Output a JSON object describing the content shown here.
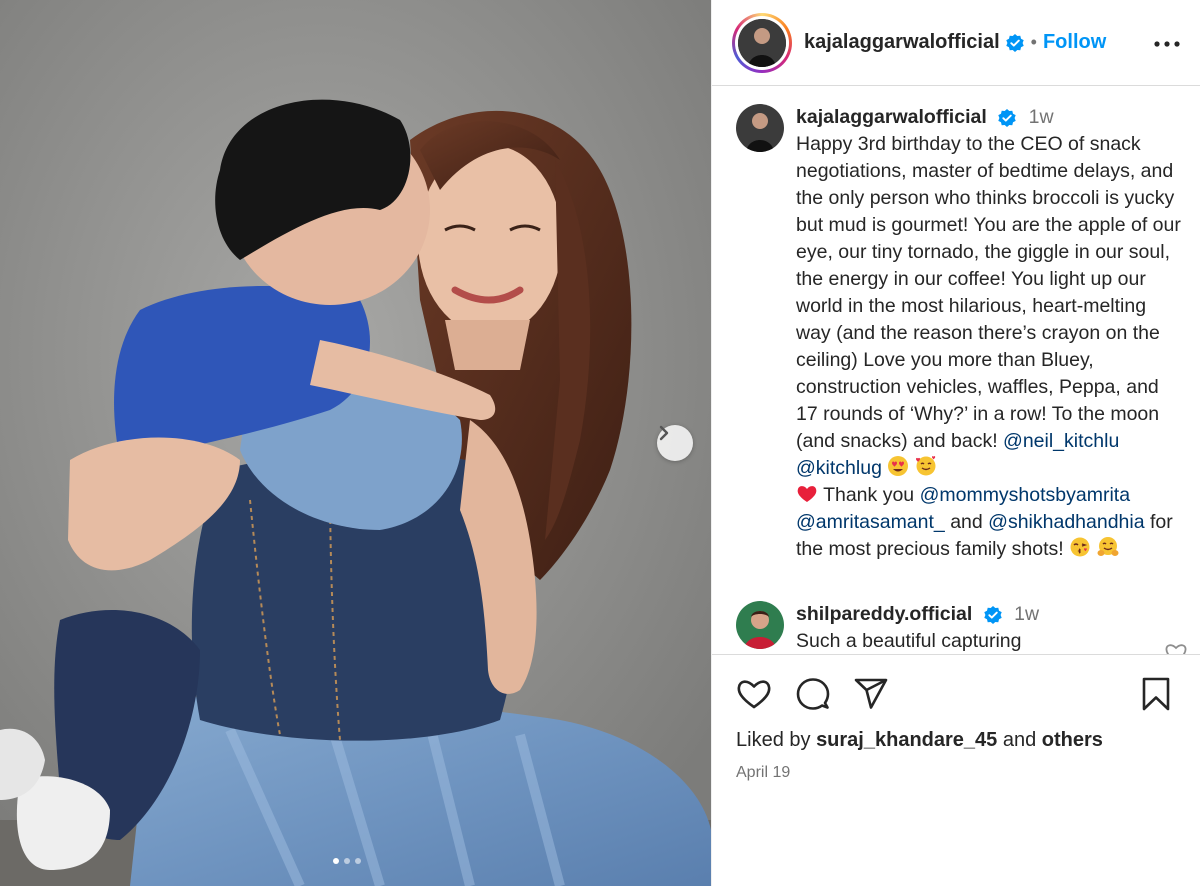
{
  "post": {
    "image_alt": "Woman in blue denim dress hugging and being kissed on the cheek by a small boy in a blue t-shirt",
    "carousel_dots": 3,
    "active_dot": 1
  },
  "header": {
    "username": "kajalaggarwalofficial",
    "separator": "•",
    "follow_label": "Follow"
  },
  "caption": {
    "username": "kajalaggarwalofficial",
    "time": "1w",
    "text_main": "Happy 3rd birthday to the CEO of snack negotiations, master of bedtime delays, and the only person who thinks broccoli is yucky but mud is gourmet! You are the apple of our eye, our tiny tornado, the giggle in our soul, the energy in our coffee! You light up our world in the most hilarious, heart-melting way (and the reason there’s crayon on the ceiling) Love you more than Bluey, construction vehicles, waffles, Peppa, and 17 rounds of ‘Why?’ in a row! To the moon (and snacks) and back!",
    "mention_1": "@neil_kitchlu",
    "mention_2": "@kitchlug",
    "thank_text": "Thank you",
    "mention_3": "@mommyshotsbyamrita",
    "mention_4": "@amritasamant_",
    "and_text": "and",
    "mention_5": "@shikhadhandhia",
    "closing_text": "for the most precious family shots!"
  },
  "reply": {
    "username": "shilpareddy.official",
    "time": "1w",
    "text": "Such a beautiful capturing"
  },
  "actions": {
    "liked_by_prefix": "Liked by",
    "liked_by_user": "suraj_khandare_45",
    "and_text": "and",
    "others_text": "others",
    "date": "April 19"
  },
  "icons": [
    "heart-icon",
    "comment-icon",
    "share-icon",
    "bookmark-icon",
    "more-icon",
    "verified-badge-icon",
    "chevron-right-icon"
  ],
  "colors": {
    "accent": "#0095f6",
    "mention": "#00376b",
    "verified": "#0095f6",
    "muted": "#737373"
  }
}
